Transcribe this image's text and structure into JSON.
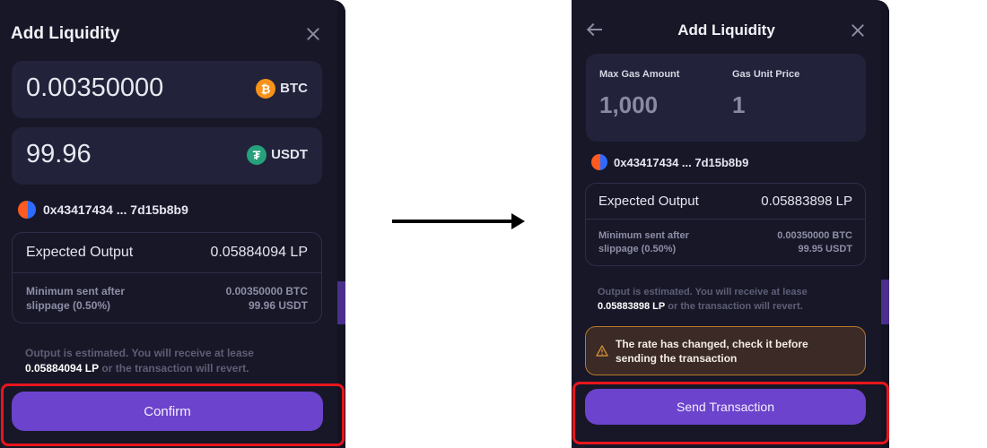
{
  "before": {
    "title": "Add Liquidity",
    "token_a": {
      "amount": "0.00350000",
      "symbol": "BTC",
      "icon": "bitcoin-icon",
      "icon_glyph": "₿"
    },
    "token_b": {
      "amount": "99.96",
      "symbol": "USDT",
      "icon": "tether-icon",
      "icon_glyph": "₮"
    },
    "address": "0x43417434 ... 7d15b8b9",
    "expected_output": {
      "label": "Expected Output",
      "value": "0.05884094 LP"
    },
    "minimum": {
      "label_line1": "Minimum sent after",
      "label_line2": "slippage (0.50%)",
      "value_a": "0.00350000 BTC",
      "value_b": "99.96 USDT"
    },
    "note": {
      "prefix": "Output is estimated. You will receive at lease",
      "amount": "0.05884094 LP",
      "suffix": " or the transaction will revert."
    },
    "button_label": "Confirm"
  },
  "after": {
    "title": "Add Liquidity",
    "gas": {
      "max_amount_label": "Max Gas Amount",
      "max_amount_value": "1,000",
      "unit_price_label": "Gas Unit Price",
      "unit_price_value": "1"
    },
    "address": "0x43417434 ... 7d15b8b9",
    "expected_output": {
      "label": "Expected Output",
      "value": "0.05883898 LP"
    },
    "minimum": {
      "label_line1": "Minimum sent after",
      "label_line2": "slippage (0.50%)",
      "value_a": "0.00350000 BTC",
      "value_b": "99.95 USDT"
    },
    "note": {
      "prefix": "Output is estimated. You will receive at lease",
      "amount": "0.05883898 LP",
      "suffix": " or the transaction will revert."
    },
    "warning": {
      "line1": "The rate has changed, check it before",
      "line2": "sending the transaction"
    },
    "button_label": "Send Transaction"
  },
  "colors": {
    "panel_bg": "#171728",
    "card_bg": "#22223a",
    "accent": "#6c43cc",
    "highlight": "#e8161c",
    "warning_border": "#b7782a",
    "btc": "#f7931a",
    "usdt": "#26a17b"
  }
}
